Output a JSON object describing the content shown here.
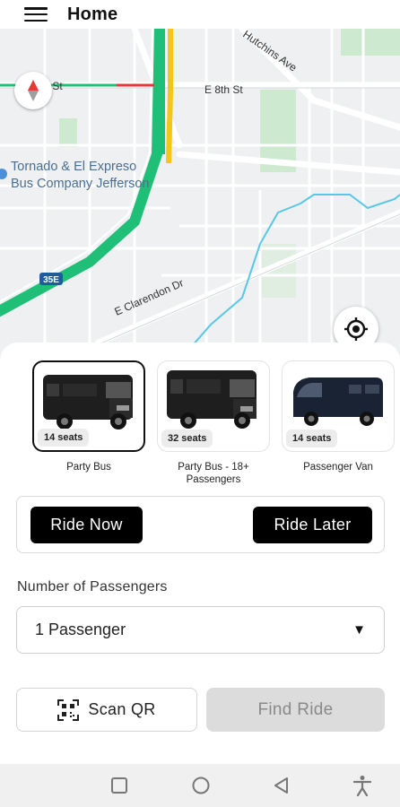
{
  "header": {
    "title": "Home",
    "menu_icon": "hamburger-menu-icon"
  },
  "map": {
    "streets": {
      "e_8th_left": "E 8th St",
      "e_8th_right": "E 8th St",
      "hutchins": "Hutchins Ave",
      "clarendon": "E Clarendon Dr",
      "highway_shield": "35E"
    },
    "poi": {
      "line1": "Tornado & El Expreso",
      "line2": "Bus Company Jefferson"
    },
    "compass_icon": "compass-icon",
    "locate_icon": "my-location-icon",
    "colors": {
      "highway_green": "#1fbf77",
      "highway_yellow": "#f5c518",
      "traffic_red": "#e53935",
      "water": "#58c7e8",
      "park": "#cde9cf"
    }
  },
  "vehicles": [
    {
      "name": "Party Bus",
      "seats": "14 seats",
      "selected": true
    },
    {
      "name": "Party Bus - 18+ Passengers",
      "seats": "32 seats",
      "selected": false
    },
    {
      "name": "Passenger Van",
      "seats": "14 seats",
      "selected": false
    }
  ],
  "ride_type": {
    "now_label": "Ride Now",
    "later_label": "Ride Later"
  },
  "passengers": {
    "label": "Number of Passengers",
    "selected": "1 Passenger",
    "arrow": "▼"
  },
  "actions": {
    "scan_label": "Scan QR",
    "find_label": "Find Ride"
  },
  "system_nav": {
    "items": [
      "recent-apps-icon",
      "home-icon",
      "back-icon",
      "accessibility-icon"
    ]
  }
}
